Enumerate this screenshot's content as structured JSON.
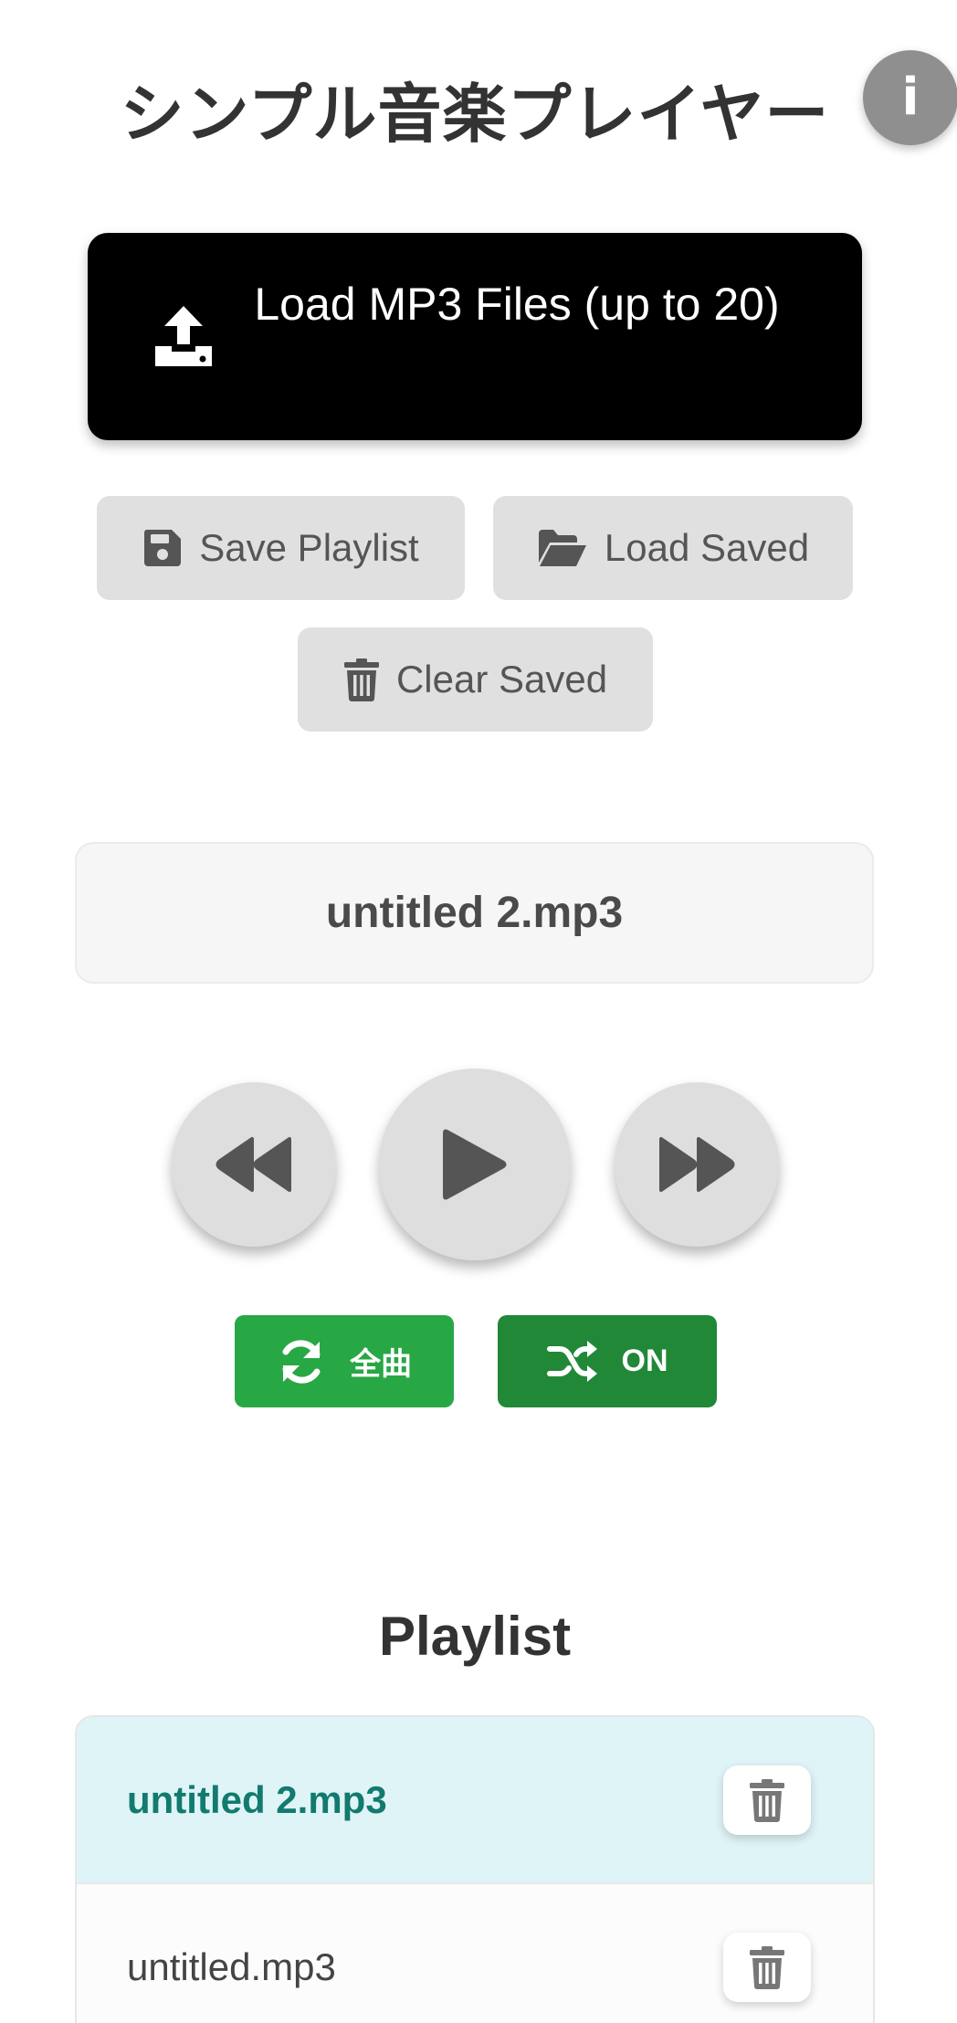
{
  "app": {
    "title": "シンプル音楽プレイヤー",
    "info_label": "i"
  },
  "load_files": {
    "label": "Load MP3 Files (up to 20)",
    "icon": "upload-icon"
  },
  "storage": {
    "save_label": "Save Playlist",
    "save_icon": "floppy-disk-icon",
    "load_label": "Load Saved",
    "load_icon": "folder-open-icon",
    "clear_label": "Clear Saved",
    "clear_icon": "trash-icon"
  },
  "player": {
    "now_playing": "untitled 2.mp3",
    "prev_icon": "backward-icon",
    "play_icon": "play-icon",
    "next_icon": "forward-icon"
  },
  "modes": {
    "repeat_label": "全曲",
    "repeat_icon": "repeat-icon",
    "shuffle_label": "ON",
    "shuffle_icon": "shuffle-icon"
  },
  "playlist": {
    "title": "Playlist",
    "items": [
      {
        "name": "untitled 2.mp3",
        "active": true
      },
      {
        "name": "untitled.mp3",
        "active": false
      }
    ]
  },
  "colors": {
    "primary_button": "#000000",
    "repeat_green": "#28a745",
    "shuffle_green": "#218838",
    "active_row_bg": "#dff4f7",
    "active_row_text": "#127a6e",
    "info_button": "#8f8f8f"
  }
}
